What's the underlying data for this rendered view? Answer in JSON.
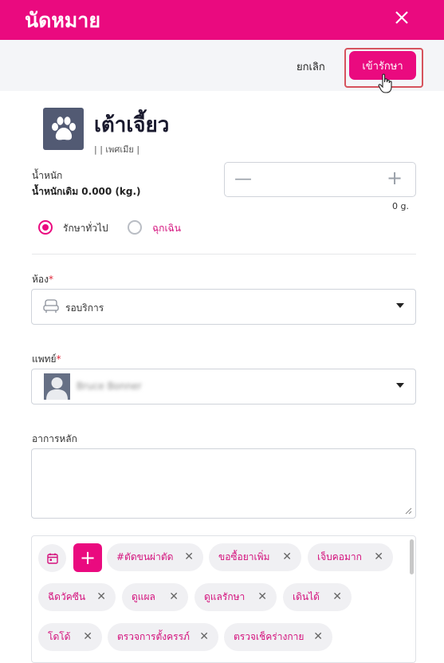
{
  "header": {
    "title": "นัดหมาย"
  },
  "actions": {
    "cancel_label": "ยกเลิก",
    "enter_label": "เข้ารักษา"
  },
  "pet": {
    "name": "เต้าเจี้ยว",
    "subtitle": "| | เพศเมีย |",
    "avatar_icon": "paw-icon"
  },
  "weight": {
    "label": "น้ำหนัก",
    "original": "น้ำหนักเดิม 0.000 (kg.)",
    "unit": "0 g."
  },
  "visit_type": {
    "options": [
      "รักษาทั่วไป",
      "ฉุกเฉิน"
    ],
    "selected": "รักษาทั่วไป"
  },
  "room": {
    "label": "ห้อง",
    "required_mark": "*",
    "value": "รอบริการ",
    "icon": "sofa-icon"
  },
  "doctor": {
    "label": "แพทย์",
    "required_mark": "*",
    "value": "Bruce Bonner"
  },
  "symptom": {
    "label": "อาการหลัก",
    "value": ""
  },
  "tags": [
    "#ตัดขนผ่าตัด",
    "ขอซื้อยาเพิ่ม",
    "เจ็บคอมาก",
    "ฉีดวัคซีน",
    "ดูแผล",
    "ดูแลรักษา",
    "เดินได้",
    "โดโด้",
    "ตรวจการตั้งครรภ์",
    "ตรวจเช็คร่างกาย"
  ],
  "colors": {
    "brand": "#ea0a7f",
    "header_bg": "#ea0a7f",
    "required": "#e0283a"
  }
}
